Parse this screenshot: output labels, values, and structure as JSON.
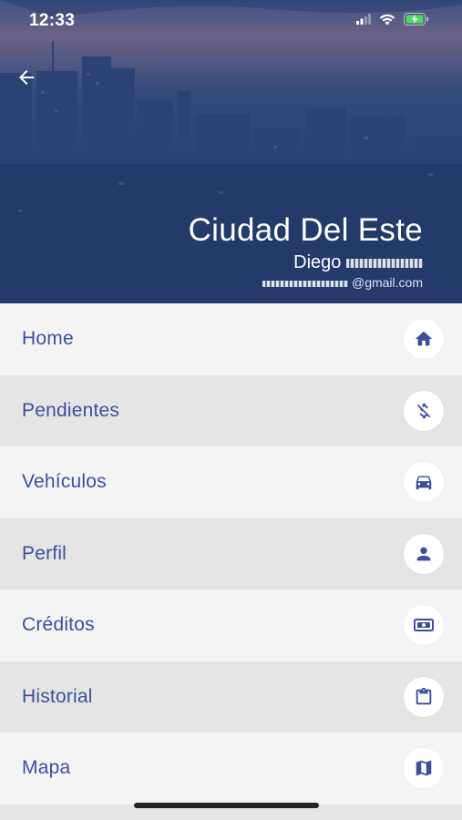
{
  "status_bar": {
    "time": "12:33",
    "icons": [
      "signal-icon",
      "wifi-icon",
      "battery-charging-icon"
    ]
  },
  "header": {
    "back_icon": "back-arrow-icon",
    "city": "Ciudad Del Este",
    "user_first_name": "Diego",
    "email_domain": "@gmail.com"
  },
  "colors": {
    "accent": "#3d4f9c",
    "row_light": "#f4f4f4",
    "row_dark": "#e5e5e5",
    "icon_bg": "#ffffff"
  },
  "menu": [
    {
      "label": "Home",
      "icon": "home-icon"
    },
    {
      "label": "Pendientes",
      "icon": "money-off-icon"
    },
    {
      "label": "Vehículos",
      "icon": "car-icon"
    },
    {
      "label": "Perfil",
      "icon": "person-icon"
    },
    {
      "label": "Créditos",
      "icon": "cash-icon"
    },
    {
      "label": "Historial",
      "icon": "clipboard-icon"
    },
    {
      "label": "Mapa",
      "icon": "map-icon"
    }
  ]
}
